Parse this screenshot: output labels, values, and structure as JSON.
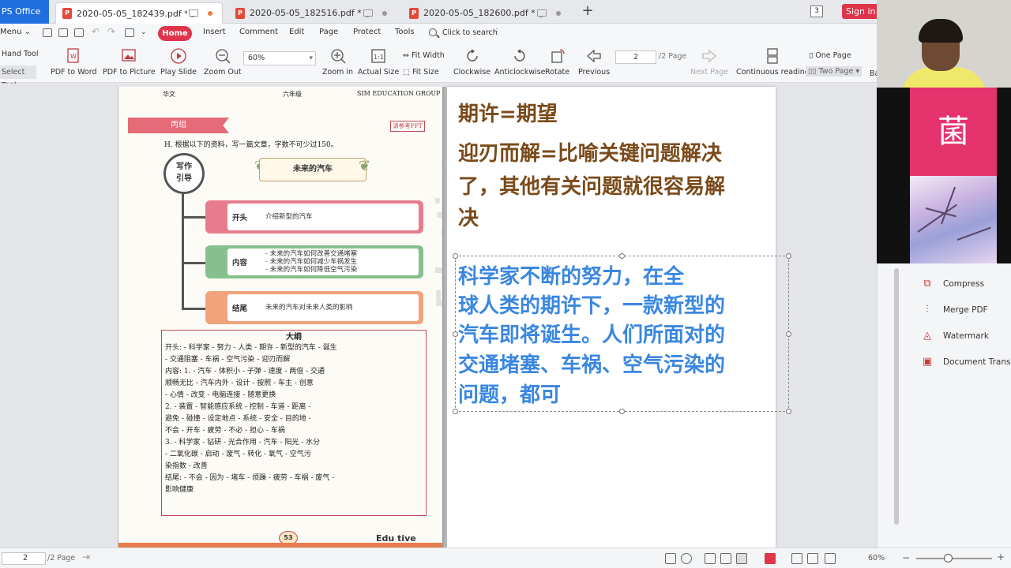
{
  "app": {
    "name": "PS Office",
    "tab_count": "3",
    "sign_in": "Sign in",
    "tabs": [
      {
        "label": "2020-05-05_182439.pdf *",
        "active": true
      },
      {
        "label": "2020-05-05_182516.pdf *",
        "active": false
      },
      {
        "label": "2020-05-05_182600.pdf *",
        "active": false
      }
    ],
    "new_tab": "+"
  },
  "menu": {
    "menu_label": "Menu",
    "items": [
      "Home",
      "Insert",
      "Comment",
      "Edit",
      "Page",
      "Protect",
      "Tools"
    ],
    "search_placeholder": "Click to search"
  },
  "toolbar": {
    "hand_tool": "Hand Tool",
    "select_tool": "Select Tool",
    "pdf_to_word": "PDF to Word",
    "pdf_to_picture": "PDF to Picture",
    "play_slide": "Play Slide",
    "zoom_out": "Zoom Out",
    "zoom_value": "60%",
    "zoom_in": "Zoom in",
    "actual_size": "Actual Size",
    "fit_width": "Fit Width",
    "fit_size": "Fit Size",
    "clockwise": "Clockwise",
    "anticlockwise": "Anticlockwise",
    "rotate": "Rotate",
    "previous": "Previous",
    "page_value": "2",
    "page_total": "/2 Page",
    "next_page": "Next Page",
    "continuous_reading": "Continuous reading",
    "one_page": "One Page",
    "two_page": "Two Page",
    "cut_label": "Ba"
  },
  "left_page": {
    "header_left": "华文",
    "header_mid": "六年级",
    "header_right": "SIM EDUCATION GROUP",
    "group": "丙组",
    "ref_tag": "请参考PPT",
    "instruction": "H. 根据以下的资料，写一篇文章，字数不可少过150。",
    "guide_line1": "写作",
    "guide_line2": "引导",
    "essay_title": "未来的汽车",
    "opening_label": "开头",
    "opening_text": "介绍新型的汽车",
    "body_label": "内容",
    "body_lines": [
      "- 未来的汽车如何改善交通堵塞",
      "- 未来的汽车如何减少车祸发生",
      "- 未来的汽车如何降低空气污染"
    ],
    "ending_label": "结尾",
    "ending_text": "未来的汽车对未来人类的影响",
    "outline_title": "大纲",
    "outline_lines": [
      "开头: - 科学家 - 努力 - 人类 - 期许 - 新型的汽车 - 诞生",
      "     - 交通阻塞 - 车祸 - 空气污染 - 迎刃而解",
      "内容: 1. - 汽车 - 体积小 - 子弹 - 速度 - 两倍 - 交通",
      "        顺畅无比 - 汽车内外 - 设计 - 按照 - 车主 - 创意",
      "        - 心情 - 改变 - 电脑连接 - 随意更换",
      "     2. - 装置 - 智能感应系统 - 控制 - 车道 - 距离 -",
      "        避免 - 碰撞 - 设定地点 - 系统 - 安全 - 目的地 -",
      "        不会 - 开车 - 疲劳 - 不必 - 担心 - 车祸",
      "     3. - 科学家 - 钻研 - 光合作用 - 汽车 - 阳光 - 水分",
      "        - 二氧化碳 - 启动 - 废气 - 转化 - 氧气 - 空气污",
      "        染指数 - 改善",
      "结尾: - 不会 - 因为 - 堵车 - 烦躁 - 疲劳 - 车祸 - 废气 -",
      "     影响健康"
    ],
    "page_number": "53",
    "footer_logo": "Edu tive",
    "watermark": "Eduative"
  },
  "right_page": {
    "line1": "期许=期望",
    "line2": "迎刃而解=比喻关键问题解决",
    "line3": "了，其他有关问题就很容易解",
    "line4": "决",
    "body": [
      "    科学家不断的努力，在全",
      "球人类的期许下，一款新型的",
      "汽车即将诞生。人们所面对的",
      "交通堵塞、车祸、空气污染的",
      "问题，都可"
    ]
  },
  "video": {
    "avatar_char": "菌"
  },
  "panel": {
    "items": [
      "Compress",
      "Merge PDF",
      "Watermark",
      "Document Translat"
    ]
  },
  "status": {
    "page_value": "2",
    "page_total": "/2 Page",
    "zoom": "60%"
  },
  "colors": {
    "accent_red": "#e0344a",
    "heading_brown": "#7a4a1a",
    "body_blue": "#3a87e0",
    "avatar_pink": "#e5336e"
  }
}
